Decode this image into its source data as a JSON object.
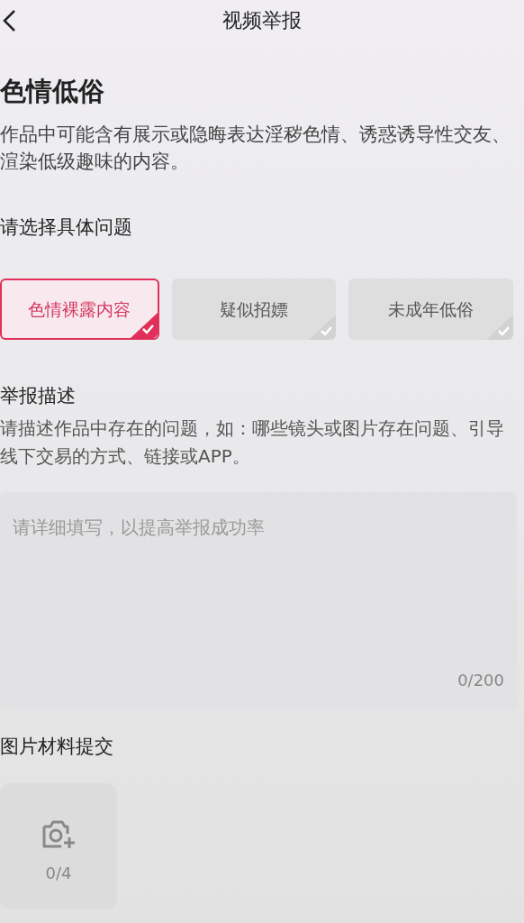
{
  "header": {
    "title": "视频举报"
  },
  "category": {
    "title": "色情低俗",
    "description": "作品中可能含有展示或隐晦表达淫秽色情、诱惑诱导性交友、渲染低级趣味的内容。"
  },
  "issue_prompt": "请选择具体问题",
  "options": [
    {
      "label": "色情裸露内容",
      "selected": true
    },
    {
      "label": "疑似招嫖",
      "selected": false
    },
    {
      "label": "未成年低俗",
      "selected": false
    }
  ],
  "report_description": {
    "title": "举报描述",
    "hint": "请描述作品中存在的问题，如：哪些镜头或图片存在问题、引导线下交易的方式、链接或APP。",
    "placeholder": "请详细填写，以提高举报成功率",
    "counter": "0/200"
  },
  "image_upload": {
    "title": "图片材料提交",
    "counter": "0/4"
  }
}
